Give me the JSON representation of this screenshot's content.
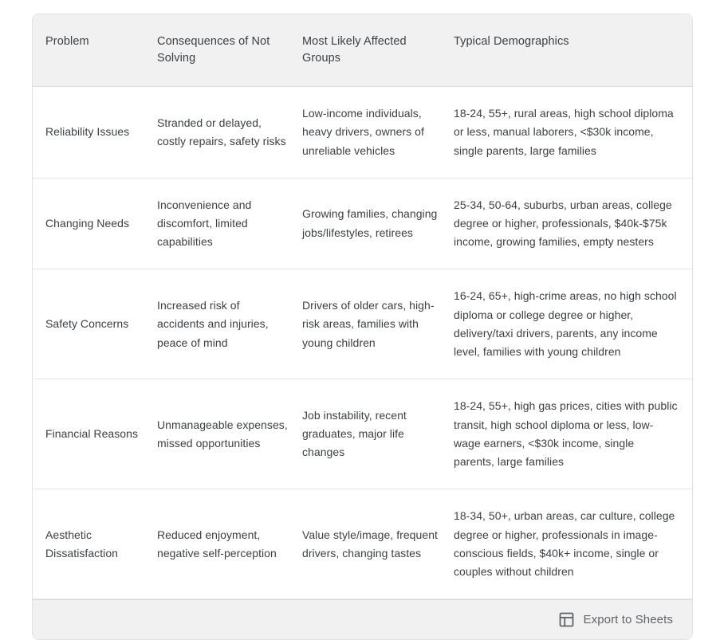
{
  "table": {
    "columns": [
      "Problem",
      "Consequences of Not Solving",
      "Most Likely Affected Groups",
      "Typical Demographics"
    ],
    "rows": [
      {
        "problem": "Reliability Issues",
        "consequences": "Stranded or delayed, costly repairs, safety risks",
        "affected_groups": "Low-income individuals, heavy drivers, owners of unreliable vehicles",
        "demographics": "18-24, 55+, rural areas, high school diploma or less, manual laborers, <$30k income, single parents, large families"
      },
      {
        "problem": "Changing Needs",
        "consequences": "Inconvenience and discomfort, limited capabilities",
        "affected_groups": "Growing families, changing jobs/lifestyles, retirees",
        "demographics": "25-34, 50-64, suburbs, urban areas, college degree or higher, professionals, $40k-$75k income, growing families, empty nesters"
      },
      {
        "problem": "Safety Concerns",
        "consequences": "Increased risk of accidents and injuries, peace of mind",
        "affected_groups": "Drivers of older cars, high-risk areas, families with young children",
        "demographics": "16-24, 65+, high-crime areas, no high school diploma or college degree or higher, delivery/taxi drivers, parents, any income level, families with young children"
      },
      {
        "problem": "Financial Reasons",
        "consequences": "Unmanageable expenses, missed opportunities",
        "affected_groups": "Job instability, recent graduates, major life changes",
        "demographics": "18-24, 55+, high gas prices, cities with public transit, high school diploma or less, low-wage earners, <$30k income, single parents, large families"
      },
      {
        "problem": "Aesthetic Dissatisfaction",
        "consequences": "Reduced enjoyment, negative self-perception",
        "affected_groups": "Value style/image, frequent drivers, changing tastes",
        "demographics": "18-34, 50+, urban areas, car culture, college degree or higher, professionals in image-conscious fields, $40k+ income, single or couples without children"
      }
    ]
  },
  "footer": {
    "export_label": "Export to Sheets",
    "export_icon": "sheets-table-icon"
  },
  "colors": {
    "header_background": "#f1f1f1",
    "footer_background": "#f1f1f1",
    "body_text": "#3c4043",
    "header_text": "#3a3f45",
    "footer_text": "#5f6368",
    "divider": "#e4e4e4",
    "card_border": "#dfe1e5"
  }
}
